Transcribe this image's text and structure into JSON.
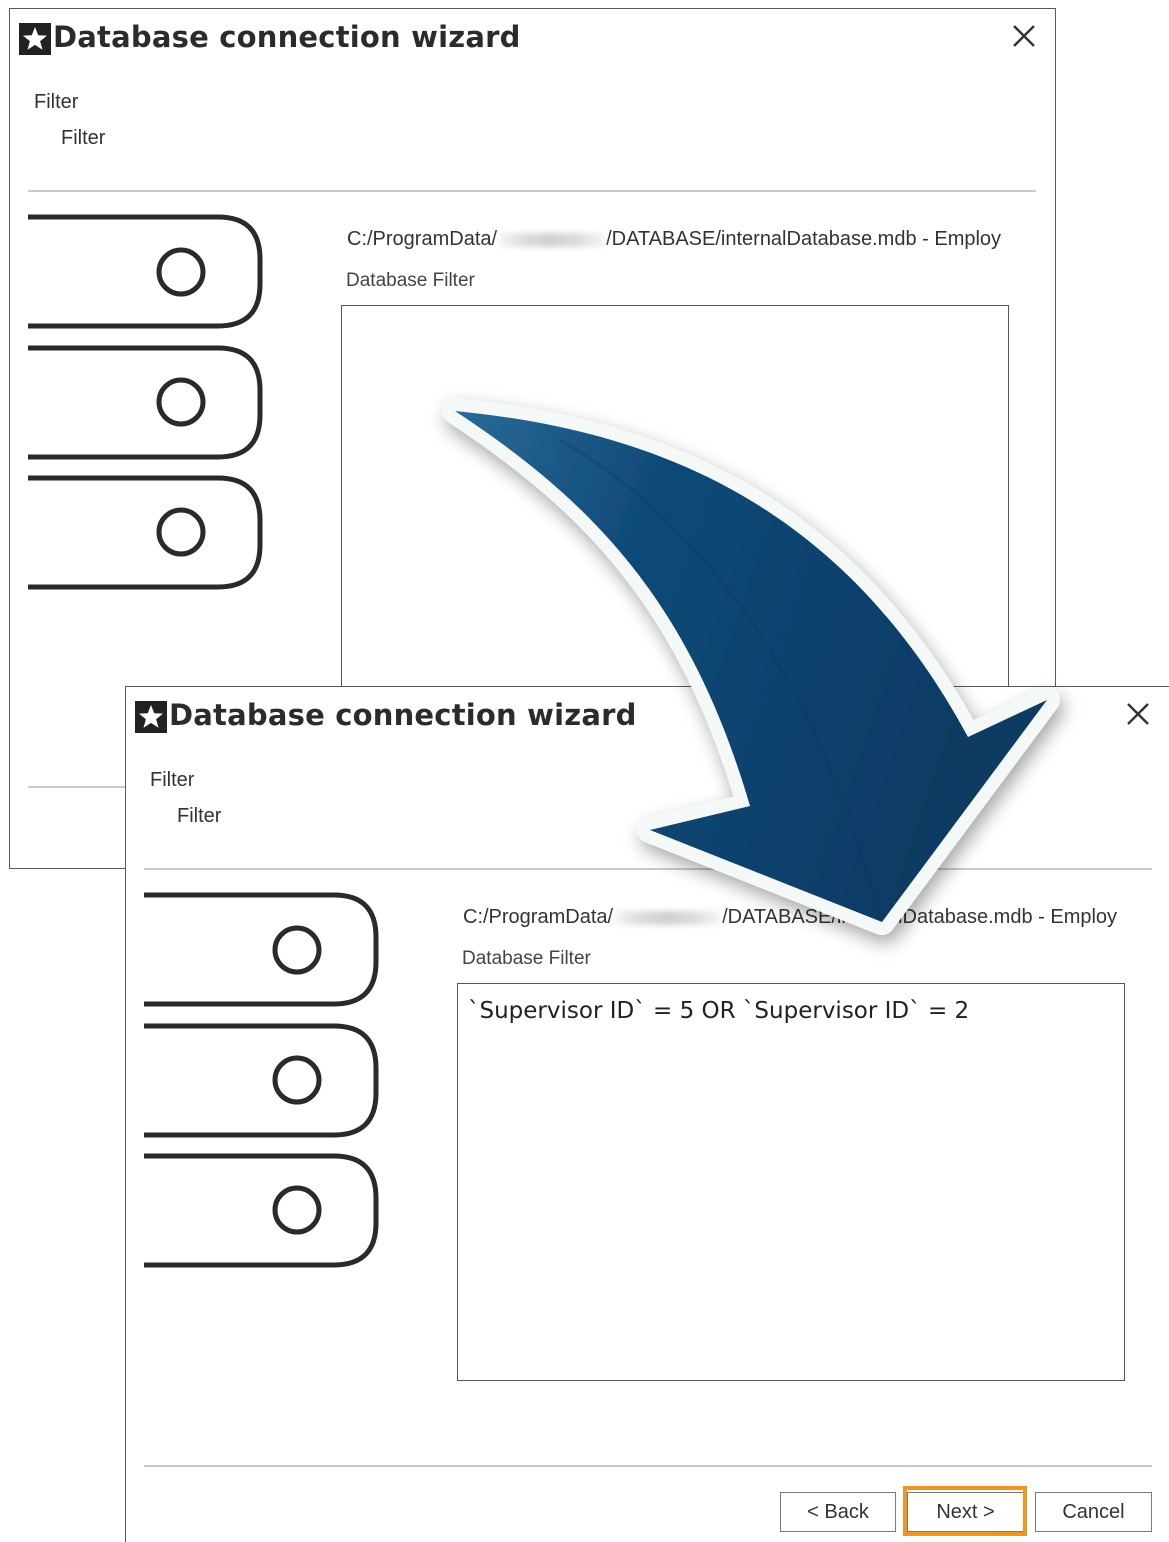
{
  "windows": [
    {
      "title": "Database connection wizard",
      "breadcrumb": [
        "Filter",
        "Filter"
      ],
      "db_path_prefix": "C:/ProgramData/",
      "db_path_suffix": "/DATABASE/internalDatabase.mdb - Employ",
      "filter_label": "Database Filter",
      "filter_value": ""
    },
    {
      "title": "Database connection wizard",
      "breadcrumb": [
        "Filter",
        "Filter"
      ],
      "db_path_prefix": "C:/ProgramData/",
      "db_path_suffix": "/DATABASE/internalDatabase.mdb - Employ",
      "filter_label": "Database Filter",
      "filter_value": "`Supervisor ID` = 5 OR `Supervisor ID` = 2",
      "buttons": {
        "back": "< Back",
        "next": "Next >",
        "cancel": "Cancel"
      }
    }
  ],
  "icons": {
    "app": "star-icon",
    "close": "close-icon",
    "database": "database-stack-icon",
    "transition": "curved-arrow-icon"
  },
  "colors": {
    "highlight": "#f0961f",
    "arrow_dark": "#0b3a62",
    "arrow_light": "#2a6a98"
  }
}
